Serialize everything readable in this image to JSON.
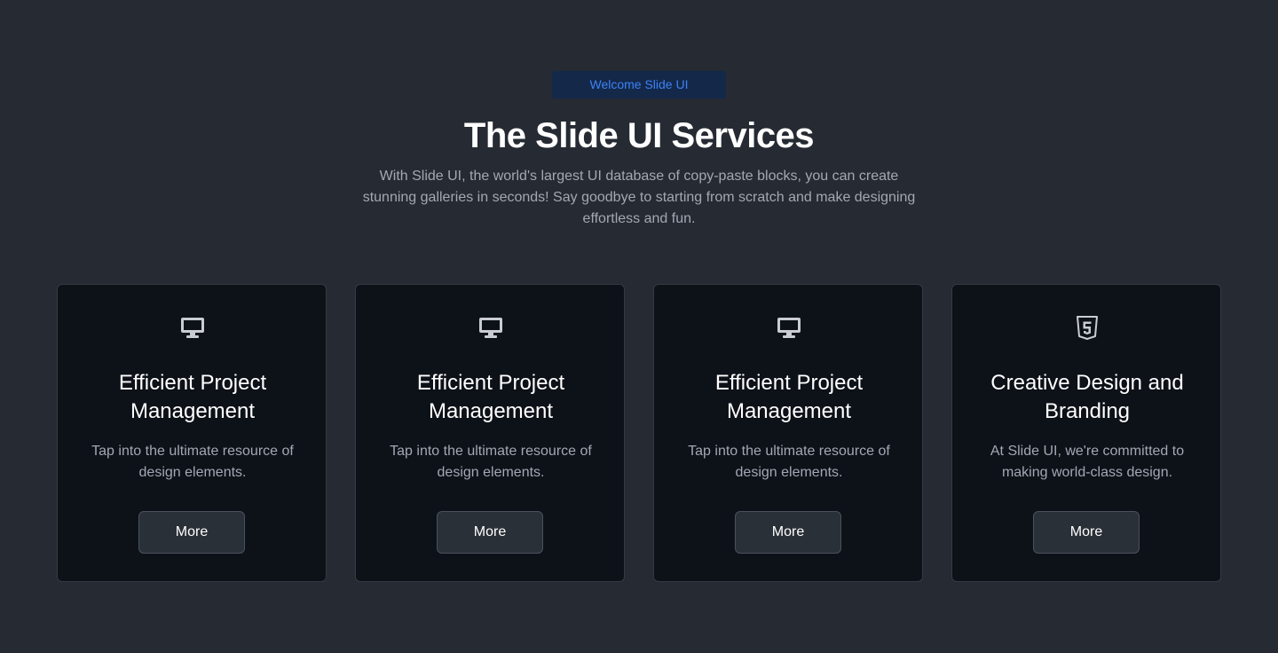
{
  "header": {
    "badge": "Welcome Slide UI",
    "title": "The Slide UI Services",
    "subtitle": "With Slide UI, the world's largest UI database of copy-paste blocks, you can create stunning galleries in seconds! Say goodbye to starting from scratch and make designing effortless and fun."
  },
  "colors": {
    "background": "#252a33",
    "card_background": "#0d1118",
    "badge_background": "#14284a",
    "accent": "#3b82f6",
    "button_background": "#2a3037"
  },
  "cards": [
    {
      "icon": "desktop-icon",
      "title": "Efficient Project Management",
      "description": "Tap into the ultimate resource of design elements.",
      "button_label": "More"
    },
    {
      "icon": "desktop-icon",
      "title": "Efficient Project Management",
      "description": "Tap into the ultimate resource of design elements.",
      "button_label": "More"
    },
    {
      "icon": "desktop-icon",
      "title": "Efficient Project Management",
      "description": "Tap into the ultimate resource of design elements.",
      "button_label": "More"
    },
    {
      "icon": "html5-icon",
      "title": "Creative Design and Branding",
      "description": "At Slide UI, we're committed to making world-class design.",
      "button_label": "More"
    }
  ]
}
